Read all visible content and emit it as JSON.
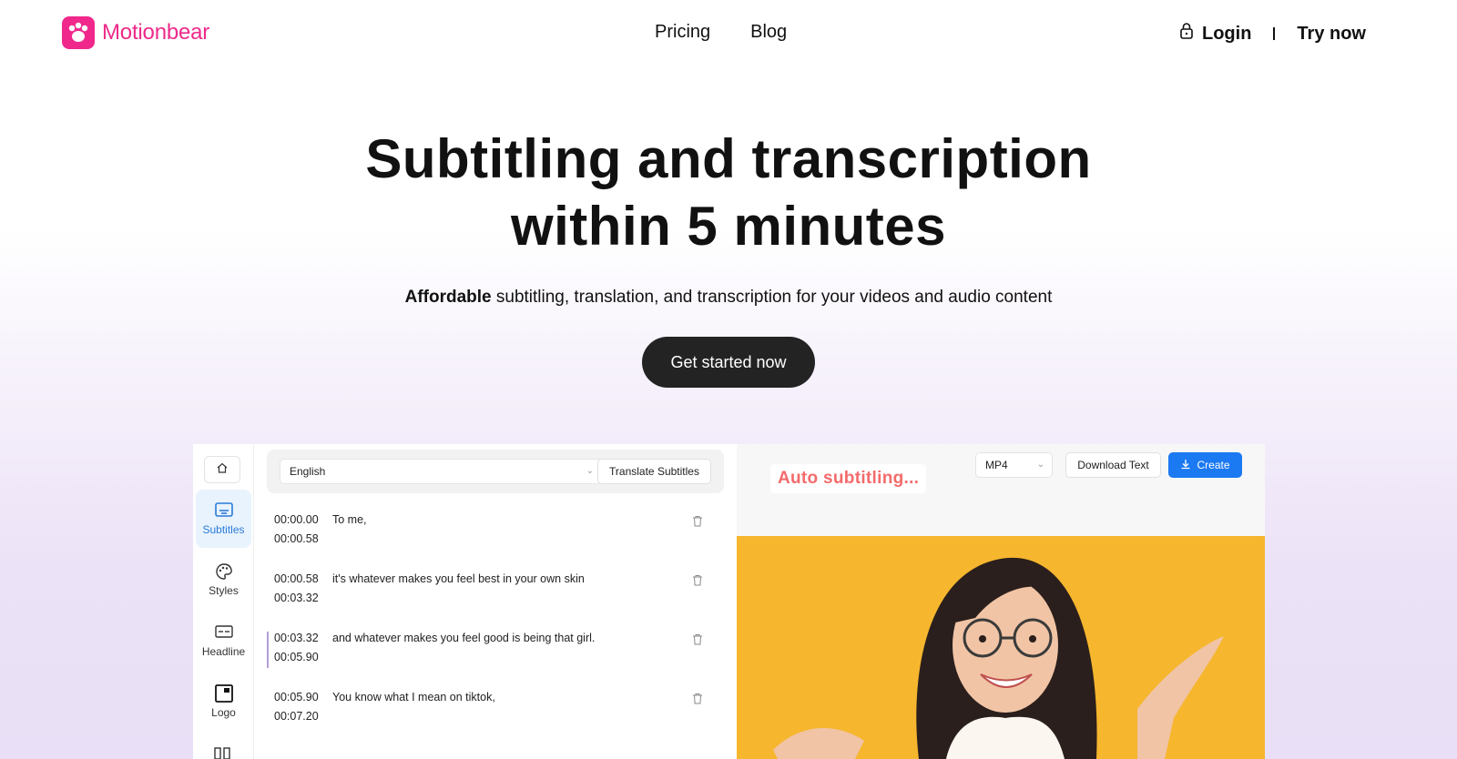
{
  "brand": {
    "name": "Motionbear",
    "color": "#ee2a8a"
  },
  "nav": {
    "links": [
      "Pricing",
      "Blog"
    ],
    "login": "Login",
    "try_now": "Try now"
  },
  "hero": {
    "title_line1": "Subtitling and transcription",
    "title_line2": "within 5 minutes",
    "subtitle_bold": "Affordable",
    "subtitle_rest": " subtitling, translation, and transcription for your videos and audio content",
    "cta": "Get started now"
  },
  "app": {
    "sidebar": [
      {
        "label": "Subtitles",
        "active": true
      },
      {
        "label": "Styles",
        "active": false
      },
      {
        "label": "Headline",
        "active": false
      },
      {
        "label": "Logo",
        "active": false
      }
    ],
    "language": "English",
    "translate_button": "Translate Subtitles",
    "subtitles": [
      {
        "start": "00:00.00",
        "end": "00:00.58",
        "text": "To me,"
      },
      {
        "start": "00:00.58",
        "end": "00:03.32",
        "text": "it's whatever makes you feel best in your own skin"
      },
      {
        "start": "00:03.32",
        "end": "00:05.90",
        "text": "and whatever makes you feel good is being that girl."
      },
      {
        "start": "00:05.90",
        "end": "00:07.20",
        "text": "You know what I mean on tiktok,"
      }
    ],
    "auto_badge": "Auto subtitling...",
    "format": "MP4",
    "download_text": "Download Text",
    "create": "Create",
    "accent": "#1b79f2"
  }
}
